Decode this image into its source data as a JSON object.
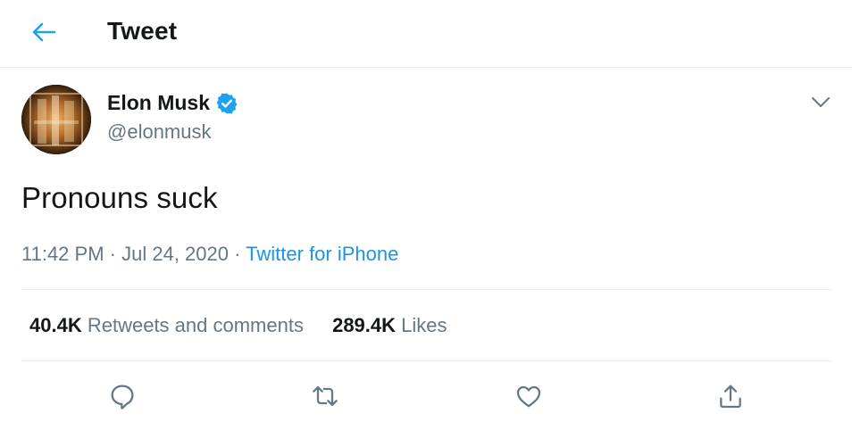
{
  "header": {
    "title": "Tweet",
    "back_icon": "arrow-left-icon"
  },
  "author": {
    "name": "Elon Musk",
    "handle": "@elonmusk",
    "verified_icon": "verified-badge-icon"
  },
  "tweet": {
    "text": "Pronouns suck",
    "time": "11:42 PM",
    "date": "Jul 24, 2020",
    "source": "Twitter for iPhone",
    "separator": "·"
  },
  "stats": {
    "retweets_count": "40.4K",
    "retweets_label": "Retweets and comments",
    "likes_count": "289.4K",
    "likes_label": "Likes"
  },
  "actions": [
    "reply-icon",
    "retweet-icon",
    "like-icon",
    "share-icon"
  ],
  "colors": {
    "accent": "#1da1f2",
    "link": "#1b95e0",
    "secondary_text": "#657786",
    "primary_text": "#14171a",
    "divider": "#e6ecf0"
  }
}
